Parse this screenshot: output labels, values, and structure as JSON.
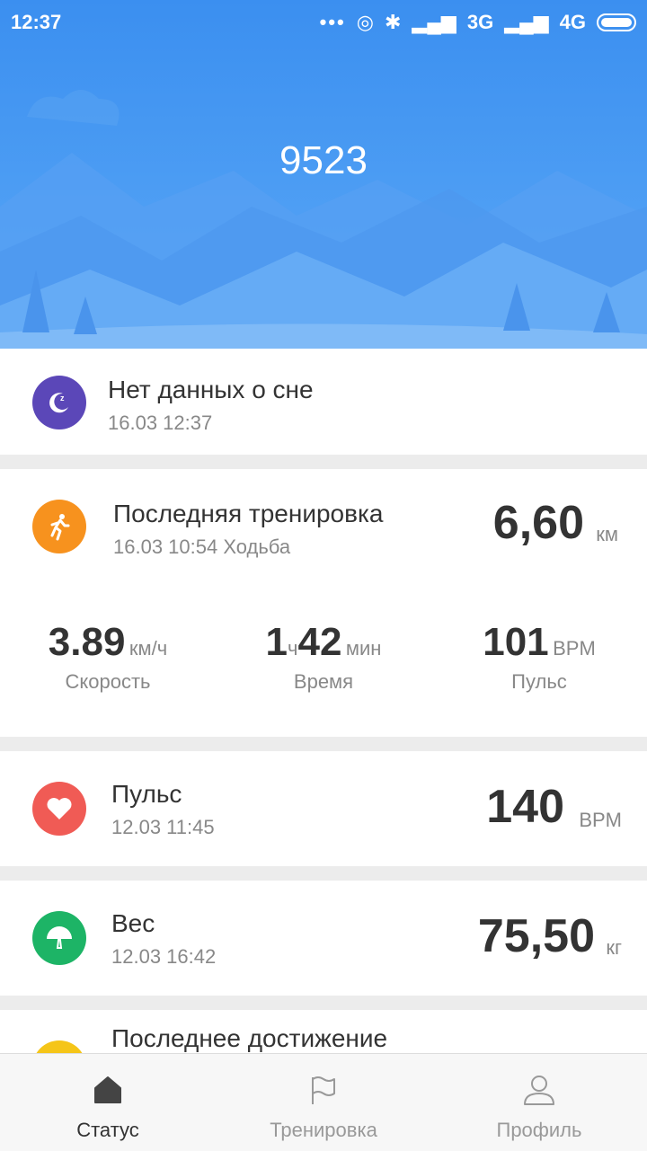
{
  "status_bar": {
    "time": "12:37",
    "network1": "3G",
    "network2": "4G"
  },
  "header": {
    "steps": "9523"
  },
  "sleep": {
    "title": "Нет данных о сне",
    "date": "16.03 12:37"
  },
  "workout": {
    "title": "Последняя тренировка",
    "date": "16.03 10:54 Ходьба",
    "distance": "6,60",
    "distance_unit": "км",
    "speed": "3.89",
    "speed_unit": "км/ч",
    "speed_label": "Скорость",
    "time_hours": "1",
    "time_hours_unit": "ч",
    "time_minutes": "42",
    "time_minutes_unit": "мин",
    "time_label": "Время",
    "pulse": "101",
    "pulse_unit": "BPM",
    "pulse_label": "Пульс"
  },
  "heart": {
    "title": "Пульс",
    "date": "12.03 11:45",
    "value": "140",
    "unit": "BPM"
  },
  "weight": {
    "title": "Вес",
    "date": "12.03 16:42",
    "value": "75,50",
    "unit": "кг"
  },
  "achievement": {
    "title": "Последнее достижение"
  },
  "nav": {
    "status": "Статус",
    "workout": "Тренировка",
    "profile": "Профиль"
  },
  "colors": {
    "header_blue": "#3b8ff0",
    "sleep": "#5b47b8",
    "workout": "#f7921e",
    "heart": "#f05b55",
    "weight": "#1db466",
    "achievement": "#f5c518"
  }
}
